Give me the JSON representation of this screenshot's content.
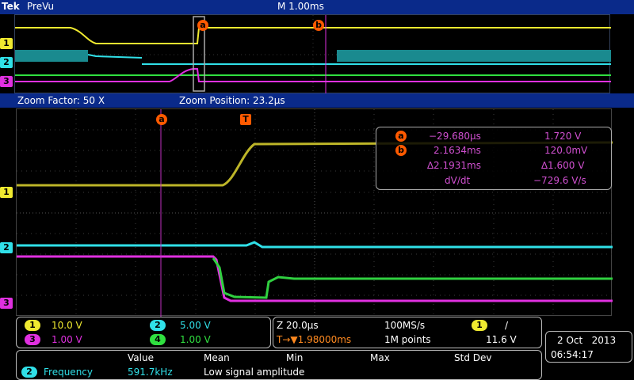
{
  "colors": {
    "ch1": "#f0ea30",
    "ch2": "#30e0e8",
    "ch3": "#e030e0",
    "ch4": "#30e040",
    "cursor_marker": "#ff5a00",
    "cursor_text": "#d050d0",
    "header": "#0a2a8a"
  },
  "topbar": {
    "brand": "Tek",
    "mode": "PreVu",
    "timebase": "M 1.00ms"
  },
  "zoom": {
    "factor": "Zoom Factor: 50 X",
    "position": "Zoom Position: 23.2µs"
  },
  "markers": {
    "a": "a",
    "b": "b",
    "trigger": "T"
  },
  "channel_labels": {
    "ch1": "1",
    "ch2": "2",
    "ch3": "3",
    "ch4": "4"
  },
  "cursors": {
    "a_time": "−29.680µs",
    "a_volt": "1.720 V",
    "b_time": "2.1634ms",
    "b_volt": "120.0mV",
    "delta_time": "∆2.1931ms",
    "delta_volt": "∆1.600 V",
    "slope_label": "dV/dt",
    "slope_value": "−729.6 V/s"
  },
  "channels": {
    "ch1_scale": "10.0 V",
    "ch2_scale": "5.00 V",
    "ch3_scale": "1.00 V",
    "ch4_scale": "1.00 V"
  },
  "horizontal": {
    "zoom_scale": "Z 20.0µs",
    "sample_rate": "100MS/s",
    "trigger_ch": "1",
    "trigger_slope": "/",
    "trigger_pos": "T→▼1.98000ms",
    "record_length": "1M points",
    "trigger_level": "11.6 V"
  },
  "datetime": {
    "date": "2 Oct   2013",
    "time": "06:54:17"
  },
  "measurements": {
    "headers": [
      "Value",
      "Mean",
      "Min",
      "Max",
      "Std Dev"
    ],
    "row_channel": "2",
    "row_name": "Frequency",
    "row_value": "591.7kHz",
    "row_note": "Low signal amplitude"
  }
}
